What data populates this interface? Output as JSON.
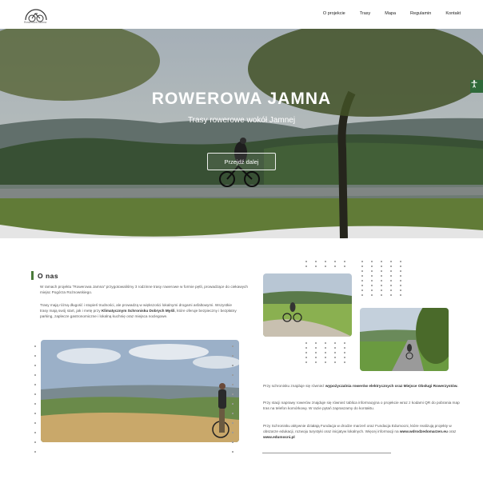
{
  "header": {
    "logo_text": "Rowerowa Jamna",
    "nav": [
      "O projekcie",
      "Trasy",
      "Mapa",
      "Regulamin",
      "Kontakt"
    ]
  },
  "hero": {
    "title": "ROWEROWA JAMNA",
    "subtitle": "Trasy rowerowe wokół Jamnej",
    "button": "Przejdź dalej"
  },
  "about": {
    "title": "O nas",
    "p1": "W ramach projektu \"Rowerowa Jamna\" przygotowaliśmy 3 rodzinne trasy rowerowe w formie pętli, prowadzące do ciekawych miejsc Pogórza Rożnowskiego.",
    "p2_a": "Trasy mają różną długość i stopień trudności, ale prowadzą w większości lokalnymi drogami asfaltowymi. Wszystkie trasy mają swój start, jak i metę przy ",
    "p2_bold": "Klimatycznym Schronisku Dobrych Myśli",
    "p2_b": ", które oferuje bezpieczny i bezpłatny parking, zaplecze gastronomiczne i lokalną kuchnię oraz miejsca noclegowe.",
    "r1_a": "Przy schronisku znajduje się również ",
    "r1_bold": "wypożyczalnia rowerów elektrycznych oraz Miejsce Obsługi Rowerzystów.",
    "r2": "Przy stacji naprawy rowerów znajduje się również tablica informacyjna o projekcie wraz z kodami QR do pobrania map tras na telefon komórkowy. W razie pytań zapraszamy do kontaktu.",
    "r3_a": "Przy Schronisku aktywnie działają Fundacja w drodze marzeń oraz Fundacja Edumocni, które realizują projekty w obszarze edukacji, rozwoju turystyki oraz inicjatyw lokalnych. Więcej informacji na ",
    "r3_link1": "www.wdrodzedomarzen.eu",
    "r3_mid": " oraz ",
    "r3_link2": "www.edumocni.pl"
  },
  "colors": {
    "accent": "#4a7a3a",
    "access_button": "#2f6a3a"
  },
  "icons": {
    "accessibility": "accessibility-icon",
    "logo": "bicycle-logo-icon"
  }
}
